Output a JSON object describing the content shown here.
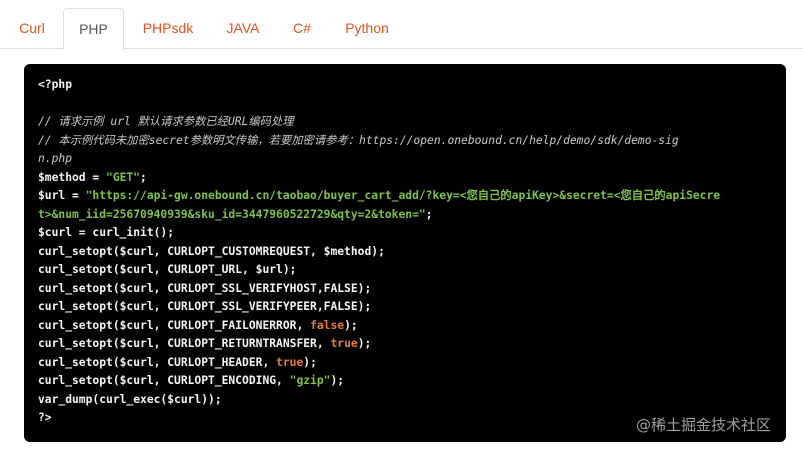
{
  "tabs": [
    {
      "label": "Curl",
      "active": false
    },
    {
      "label": "PHP",
      "active": true
    },
    {
      "label": "PHPsdk",
      "active": false
    },
    {
      "label": "JAVA",
      "active": false
    },
    {
      "label": "C#",
      "active": false
    },
    {
      "label": "Python",
      "active": false
    }
  ],
  "code": {
    "lines": [
      [
        {
          "t": "<?php",
          "c": "plain"
        }
      ],
      [],
      [
        {
          "t": "// 请求示例 url 默认请求参数已经URL编码处理",
          "c": "cmt"
        }
      ],
      [
        {
          "t": "// 本示例代码未加密secret参数明文传输，若要加密请参考：https://open.onebound.cn/help/demo/sdk/demo-sig",
          "c": "cmt"
        }
      ],
      [
        {
          "t": "n.php",
          "c": "cmt"
        }
      ],
      [
        {
          "t": "$method = ",
          "c": "plain"
        },
        {
          "t": "\"GET\"",
          "c": "str"
        },
        {
          "t": ";",
          "c": "plain"
        }
      ],
      [
        {
          "t": "$url = ",
          "c": "plain"
        },
        {
          "t": "\"https://api-gw.onebound.cn/taobao/buyer_cart_add/?key=<您自己的apiKey>&secret=<您自己的apiSecre",
          "c": "str"
        }
      ],
      [
        {
          "t": "t>&num_iid=25670940939&sku_id=3447960522729&qty=2&token=\"",
          "c": "str"
        },
        {
          "t": ";",
          "c": "plain"
        }
      ],
      [
        {
          "t": "$curl = curl_init();",
          "c": "plain"
        }
      ],
      [
        {
          "t": "curl_setopt($curl, CURLOPT_CUSTOMREQUEST, $method);",
          "c": "plain"
        }
      ],
      [
        {
          "t": "curl_setopt($curl, CURLOPT_URL, $url);",
          "c": "plain"
        }
      ],
      [
        {
          "t": "curl_setopt($curl, CURLOPT_SSL_VERIFYHOST,FALSE);",
          "c": "plain"
        }
      ],
      [
        {
          "t": "curl_setopt($curl, CURLOPT_SSL_VERIFYPEER,FALSE);",
          "c": "plain"
        }
      ],
      [
        {
          "t": "curl_setopt($curl, CURLOPT_FAILONERROR, ",
          "c": "plain"
        },
        {
          "t": "false",
          "c": "kw"
        },
        {
          "t": ");",
          "c": "plain"
        }
      ],
      [
        {
          "t": "curl_setopt($curl, CURLOPT_RETURNTRANSFER, ",
          "c": "plain"
        },
        {
          "t": "true",
          "c": "kw"
        },
        {
          "t": ");",
          "c": "plain"
        }
      ],
      [
        {
          "t": "curl_setopt($curl, CURLOPT_HEADER, ",
          "c": "plain"
        },
        {
          "t": "true",
          "c": "kw"
        },
        {
          "t": ");",
          "c": "plain"
        }
      ],
      [
        {
          "t": "curl_setopt($curl, CURLOPT_ENCODING, ",
          "c": "plain"
        },
        {
          "t": "\"gzip\"",
          "c": "str"
        },
        {
          "t": ");",
          "c": "plain"
        }
      ],
      [
        {
          "t": "var_dump(curl_exec($curl));",
          "c": "plain"
        }
      ],
      [
        {
          "t": "?>",
          "c": "plain"
        }
      ]
    ]
  },
  "watermark": "@稀土掘金技术社区",
  "colors": {
    "tab_accent": "#e0531f",
    "code_bg": "#000000",
    "string": "#7fc24c",
    "keyword": "#e67e3a",
    "comment": "#c9c9c9"
  }
}
